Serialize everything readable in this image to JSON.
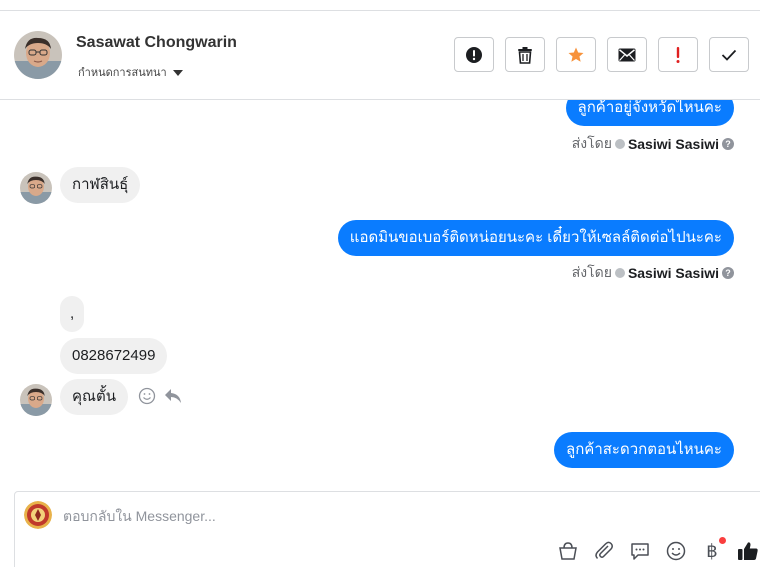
{
  "header": {
    "contact_name": "Sasawat Chongwarin",
    "assign_label": "กำหนดการสนทนา",
    "actions": [
      {
        "name": "spam-button",
        "icon": "exclamation-circle-icon"
      },
      {
        "name": "delete-button",
        "icon": "trash-icon"
      },
      {
        "name": "star-button",
        "icon": "star-icon",
        "color": "#f7923b"
      },
      {
        "name": "mark-unread-button",
        "icon": "envelope-icon"
      },
      {
        "name": "follow-up-button",
        "icon": "exclamation-icon",
        "color": "#e02020"
      },
      {
        "name": "done-button",
        "icon": "check-icon"
      }
    ]
  },
  "messages": [
    {
      "direction": "out",
      "text": "ลูกค้าอยู่จังหวัดไหนคะ"
    },
    {
      "direction": "meta",
      "prefix": "ส่งโดย",
      "sender": "Sasiwi Sasiwi"
    },
    {
      "direction": "in",
      "text": "กาฬสินธุ์"
    },
    {
      "direction": "out",
      "text": "แอดมินขอเบอร์ติดหน่อยนะคะ เดี๋ยวให้เซลล์ติดต่อไปนะคะ"
    },
    {
      "direction": "meta",
      "prefix": "ส่งโดย",
      "sender": "Sasiwi Sasiwi"
    },
    {
      "direction": "in",
      "text": ","
    },
    {
      "direction": "in",
      "text": "0828672499"
    },
    {
      "direction": "in",
      "text": "คุณตั้น"
    },
    {
      "direction": "out",
      "text": "ลูกค้าสะดวกตอนไหนคะ"
    }
  ],
  "composer": {
    "placeholder": "ตอบกลับใน Messenger...",
    "baht_symbol": "฿"
  },
  "colors": {
    "accent": "#0a7cff",
    "incoming_bubble": "#f0f0f0",
    "star": "#f7923b",
    "alert": "#e02020"
  }
}
